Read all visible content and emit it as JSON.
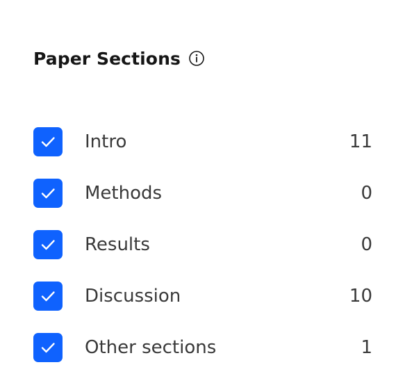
{
  "panel": {
    "title": "Paper Sections",
    "info_icon": "info-circle-icon",
    "check_icon": "checkmark-icon",
    "accent_color": "#0f62fe"
  },
  "sections": [
    {
      "label": "Intro",
      "count": "11",
      "checked": true
    },
    {
      "label": "Methods",
      "count": "0",
      "checked": true
    },
    {
      "label": "Results",
      "count": "0",
      "checked": true
    },
    {
      "label": "Discussion",
      "count": "10",
      "checked": true
    },
    {
      "label": "Other sections",
      "count": "1",
      "checked": true
    }
  ]
}
